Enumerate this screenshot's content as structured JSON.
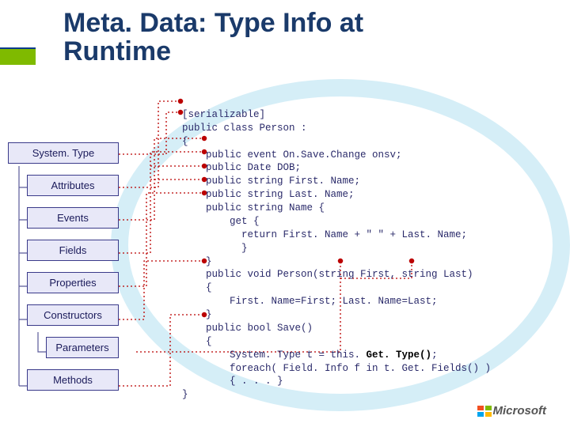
{
  "title_line1": "Meta. Data: Type Info at",
  "title_line2": "Runtime",
  "sidebar": {
    "type": "System. Type",
    "attributes": "Attributes",
    "events": "Events",
    "fields": "Fields",
    "properties": "Properties",
    "constructors": "Constructors",
    "parameters": "Parameters",
    "methods": "Methods"
  },
  "code": {
    "l01": "[serializable]",
    "l02": "public class Person :",
    "l03": "{",
    "l04": "    public event On.Save.Change onsv;",
    "l05": "    public Date DOB;",
    "l06": "    public string First. Name;",
    "l07": "    public string Last. Name;",
    "l08": "    public string Name {",
    "l09": "        get {",
    "l10": "          return First. Name + \" \" + Last. Name;",
    "l11": "          }",
    "l12": "    }",
    "l13": "    public void Person(string First, string Last)",
    "l14": "    {",
    "l15": "        First. Name=First; Last. Name=Last;",
    "l16": "    }",
    "l17": "    public bool Save()",
    "l18": "    {",
    "l19a": "        System. Type t = this. ",
    "l19b": "Get. Type()",
    "l19c": ";",
    "l20": "        foreach( Field. Info f in t. Get. Fields() )",
    "l21": "        { . . . }",
    "l22": "}"
  },
  "logo": "Microsoft"
}
